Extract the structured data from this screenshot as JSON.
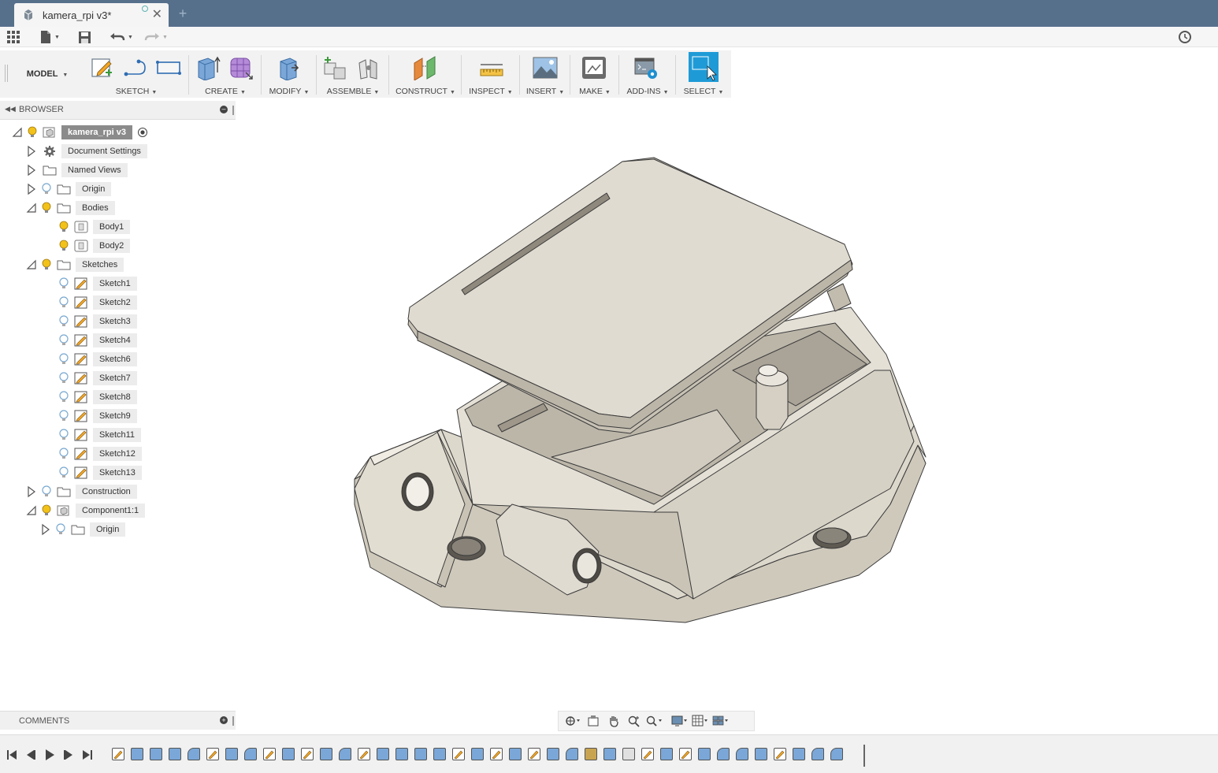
{
  "tab": {
    "title": "kamera_rpi v3*",
    "close": "✕",
    "new_tab": "+"
  },
  "toolbar": {
    "workspace": "MODEL",
    "groups": {
      "sketch": "SKETCH",
      "create": "CREATE",
      "modify": "MODIFY",
      "assemble": "ASSEMBLE",
      "construct": "CONSTRUCT",
      "inspect": "INSPECT",
      "insert": "INSERT",
      "make": "MAKE",
      "addins": "ADD-INS",
      "select": "SELECT"
    }
  },
  "browser": {
    "title": "BROWSER",
    "root": "kamera_rpi v3",
    "items": [
      {
        "label": "Document Settings"
      },
      {
        "label": "Named Views"
      },
      {
        "label": "Origin"
      },
      {
        "label": "Bodies"
      },
      {
        "label": "Body1"
      },
      {
        "label": "Body2"
      },
      {
        "label": "Sketches"
      },
      {
        "label": "Sketch1"
      },
      {
        "label": "Sketch2"
      },
      {
        "label": "Sketch3"
      },
      {
        "label": "Sketch4"
      },
      {
        "label": "Sketch6"
      },
      {
        "label": "Sketch7"
      },
      {
        "label": "Sketch8"
      },
      {
        "label": "Sketch9"
      },
      {
        "label": "Sketch11"
      },
      {
        "label": "Sketch12"
      },
      {
        "label": "Sketch13"
      },
      {
        "label": "Construction"
      },
      {
        "label": "Component1:1"
      },
      {
        "label": "Origin"
      }
    ]
  },
  "comments": {
    "title": "COMMENTS"
  },
  "colors": {
    "tabbar": "#56708c",
    "accent": "#1e9bd7",
    "model": "#ddd8cc",
    "bulb_on": "#f2c21b",
    "bulb_off": "#9cc3e0"
  }
}
